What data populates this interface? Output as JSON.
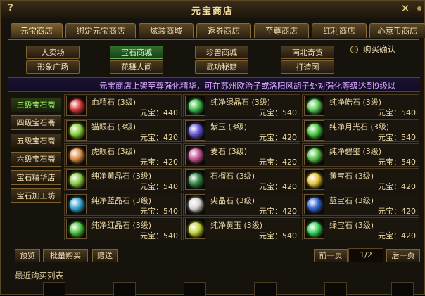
{
  "window": {
    "title": "元宝商店",
    "help": "?",
    "close": "✕"
  },
  "tabs": [
    {
      "label": "元宝商店",
      "active": true
    },
    {
      "label": "绑定元宝商店",
      "active": false
    },
    {
      "label": "炫装商城",
      "active": false
    },
    {
      "label": "返券商店",
      "active": false
    },
    {
      "label": "至尊商店",
      "active": false
    },
    {
      "label": "红利商店",
      "active": false
    },
    {
      "label": "心意币商店",
      "active": false
    }
  ],
  "categories": [
    {
      "label": "大卖场",
      "active": false
    },
    {
      "label": "宝石商城",
      "active": true
    },
    {
      "label": "珍兽商城",
      "active": false
    },
    {
      "label": "南北奇货",
      "active": false
    },
    {
      "label": "形象广场",
      "active": false
    },
    {
      "label": "花舞人间",
      "active": false
    },
    {
      "label": "武功秘籍",
      "active": false
    },
    {
      "label": "打造图",
      "active": false
    }
  ],
  "confirm_purchase": "购买确认",
  "announcement": "元宝商店上架至尊强化精华，可在苏州欧治子或洛阳风胡子处对强化等级达到9级以",
  "subnav": [
    {
      "label": "三级宝石斋",
      "active": true
    },
    {
      "label": "四级宝石斋",
      "active": false
    },
    {
      "label": "五级宝石斋",
      "active": false
    },
    {
      "label": "六级宝石斋",
      "active": false
    },
    {
      "label": "宝石精华店",
      "active": false
    },
    {
      "label": "宝石加工坊",
      "active": false
    }
  ],
  "items": [
    {
      "name": "血精石 (3级)",
      "price": "元宝：440",
      "color": "#d93a3a"
    },
    {
      "name": "纯净绿晶石 (3级)",
      "price": "元宝：540",
      "color": "#3fbf4a"
    },
    {
      "name": "纯净皓石 (3级)",
      "price": "元宝：540",
      "color": "#5fd05a"
    },
    {
      "name": "猫眼石 (3级)",
      "price": "元宝：420",
      "color": "#8bd23a"
    },
    {
      "name": "紫玉 (3级)",
      "price": "元宝：420",
      "color": "#6a5ad8"
    },
    {
      "name": "纯净月光石 (3级)",
      "price": "元宝：540",
      "color": "#4fcf4a"
    },
    {
      "name": "虎眼石 (3级)",
      "price": "元宝：420",
      "color": "#e0904a"
    },
    {
      "name": "麦石 (3级)",
      "price": "元宝：420",
      "color": "#c85a9a"
    },
    {
      "name": "纯净碧玺 (3级)",
      "price": "元宝：540",
      "color": "#5ac84a"
    },
    {
      "name": "纯净黄晶石 (3级)",
      "price": "元宝：540",
      "color": "#8ad040"
    },
    {
      "name": "石榴石 (3级)",
      "price": "元宝：420",
      "color": "#3a8a4a"
    },
    {
      "name": "黄宝石 (3级)",
      "price": "元宝：420",
      "color": "#e8c83a"
    },
    {
      "name": "纯净蓝晶石 (3级)",
      "price": "元宝：540",
      "color": "#3aa8d8"
    },
    {
      "name": "尖晶石 (3级)",
      "price": "元宝：420",
      "color": "#d8d8d8"
    },
    {
      "name": "蓝宝石 (3级)",
      "price": "元宝：420",
      "color": "#3a6ad8"
    },
    {
      "name": "纯净红晶石 (3级)",
      "price": "元宝：540",
      "color": "#50c840"
    },
    {
      "name": "纯净黄玉 (3级)",
      "price": "元宝：540",
      "color": "#c8d83a"
    },
    {
      "name": "绿宝石 (3级)",
      "price": "元宝：420",
      "color": "#3ad860"
    }
  ],
  "bottom": {
    "preview": "预览",
    "bulk_buy": "批量购买",
    "gift": "赠送",
    "prev_page": "前一页",
    "page": "1/2",
    "next_page": "后一页",
    "recent_label": "最近购买列表"
  }
}
